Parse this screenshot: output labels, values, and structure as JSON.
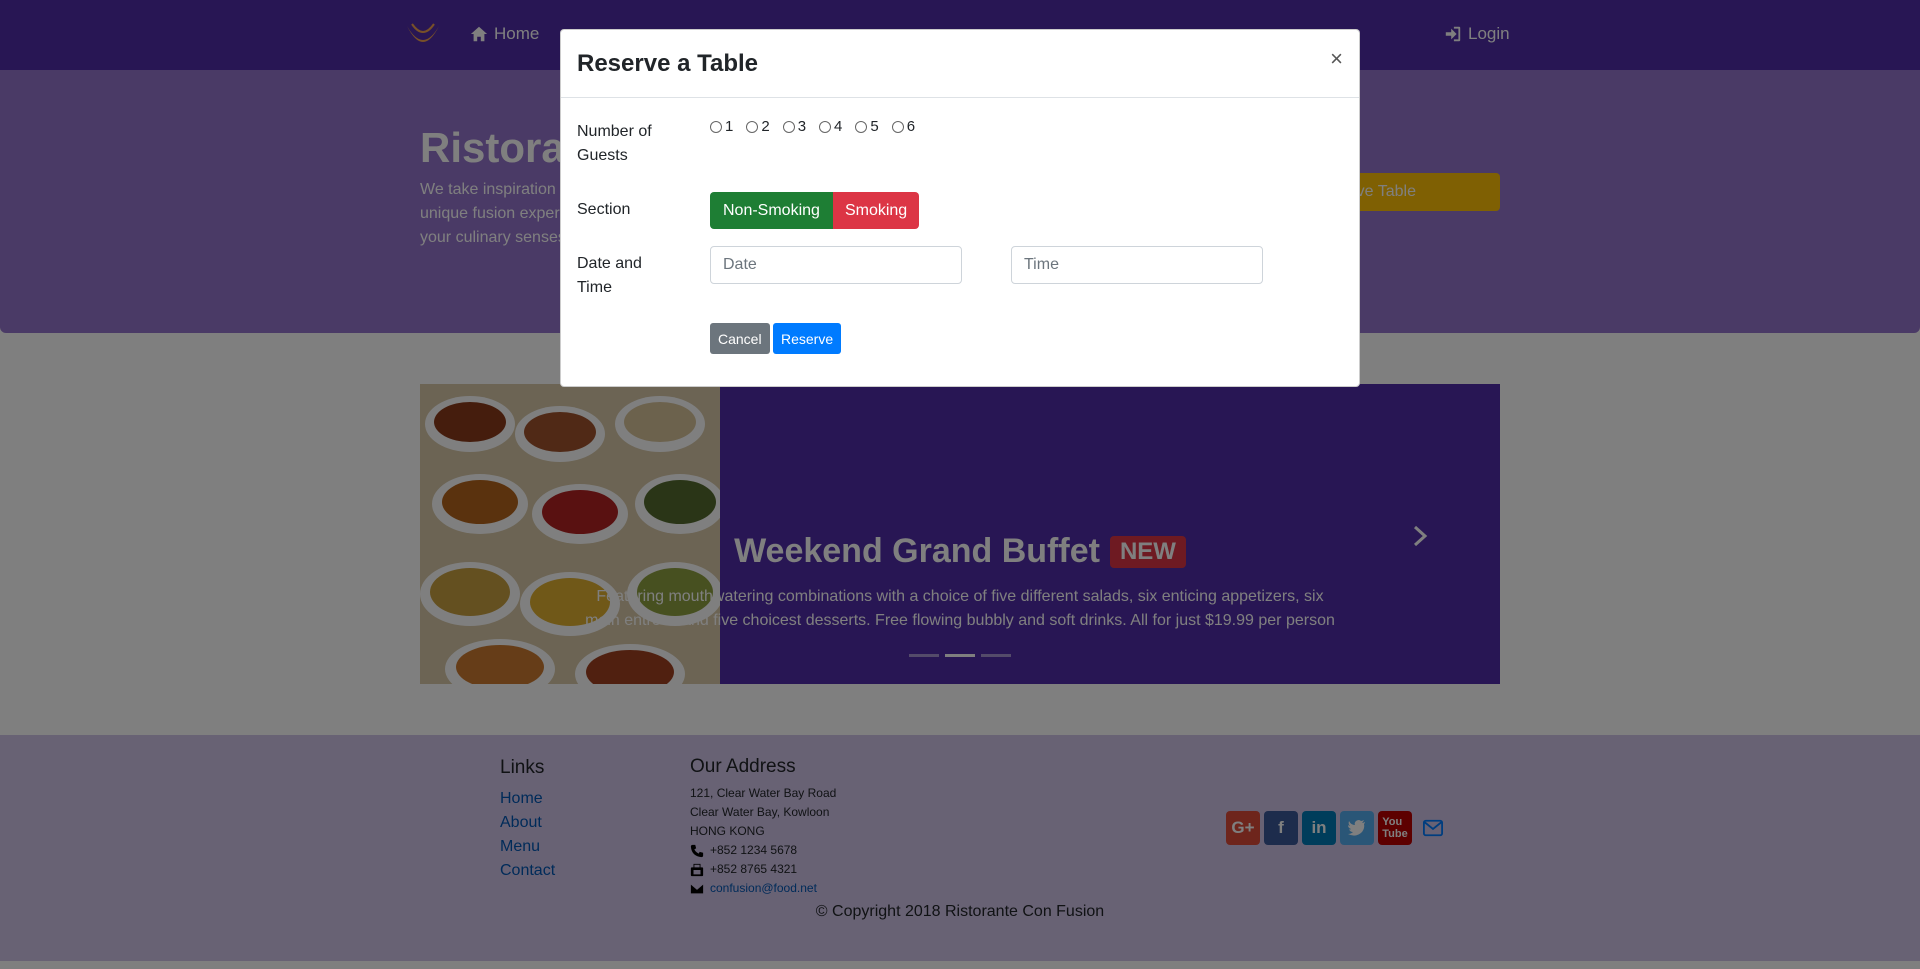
{
  "navbar": {
    "home": "Home",
    "login": "Login"
  },
  "jumbotron": {
    "title": "Ristorante Con Fusion",
    "text": "We take inspiration from the World's best cuisines, and create a unique fusion experience. Our lipsmacking creations will tickle your culinary senses!",
    "reserve_button": "Reserve Table"
  },
  "carousel": {
    "title": "Weekend Grand Buffet",
    "badge": "NEW",
    "text": "Featuring mouthwatering combinations with a choice of five different salads, six enticing appetizers, six main entrees and five choicest desserts. Free flowing bubbly and soft drinks. All for just $19.99 per person",
    "active_slide": 2,
    "slide_count": 3
  },
  "footer": {
    "links_title": "Links",
    "links": [
      "Home",
      "About",
      "Menu",
      "Contact"
    ],
    "address_title": "Our Address",
    "address_line1": "121, Clear Water Bay Road",
    "address_line2": "Clear Water Bay, Kowloon",
    "address_line3": "HONG KONG",
    "phone": "+852 1234 5678",
    "fax": "+852 8765 4321",
    "email": "confusion@food.net",
    "copyright": "© Copyright 2018 Ristorante Con Fusion"
  },
  "social": {
    "icons": [
      "google-plus-icon",
      "facebook-icon",
      "linkedin-icon",
      "twitter-icon",
      "youtube-icon",
      "mail-icon"
    ],
    "colors": {
      "google": "#dd4b39",
      "facebook": "#3b5998",
      "linkedin": "#007bb6",
      "twitter": "#55acee",
      "youtube": "#bb0000",
      "mail": "#007bff"
    }
  },
  "modal": {
    "title": "Reserve a Table",
    "close": "×",
    "guests_label": "Number of Guests",
    "guest_options": [
      "1",
      "2",
      "3",
      "4",
      "5",
      "6"
    ],
    "section_label": "Section",
    "section_options": [
      "Non-Smoking",
      "Smoking"
    ],
    "datetime_label": "Date and Time",
    "date_placeholder": "Date",
    "time_placeholder": "Time",
    "cancel": "Cancel",
    "reserve": "Reserve"
  },
  "colors": {
    "navbar": "#512da8",
    "jumbotron": "#9575cd",
    "footer": "#d1c4e9",
    "warning": "#ffc107",
    "success": "#1e7e34",
    "danger": "#dc3545",
    "primary": "#007bff",
    "secondary": "#6c757d"
  }
}
